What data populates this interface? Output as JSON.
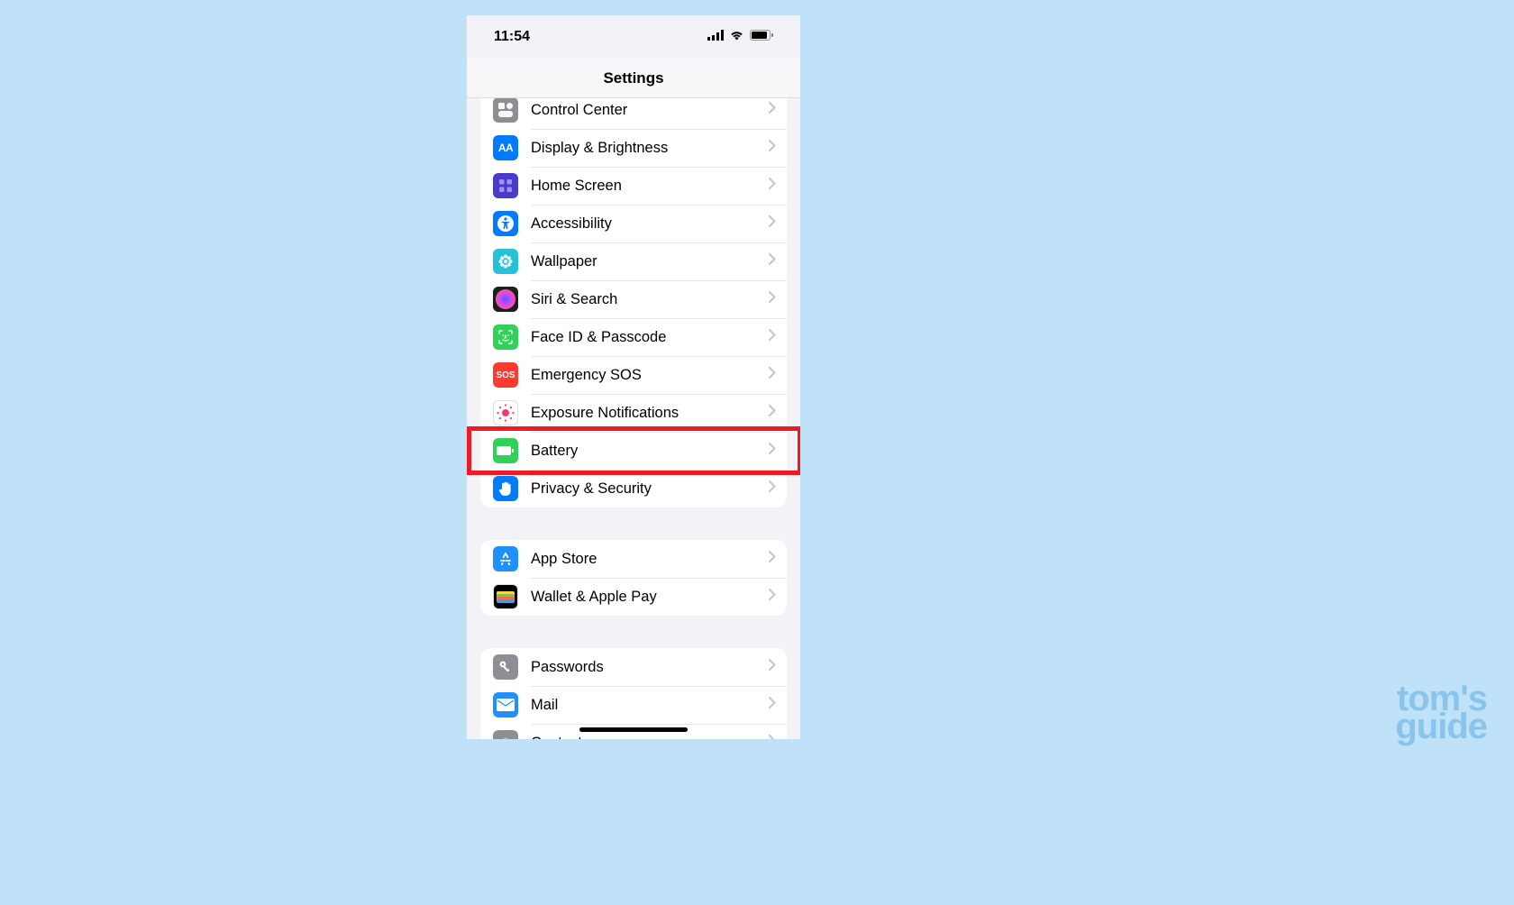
{
  "status": {
    "time": "11:54"
  },
  "header": {
    "title": "Settings"
  },
  "groups": [
    {
      "rows": [
        {
          "id": "control-center",
          "label": "Control Center",
          "icon_bg": "#8e8e93",
          "icon": "controlcenter"
        },
        {
          "id": "display-brightness",
          "label": "Display & Brightness",
          "icon_bg": "#007aff",
          "icon": "aa"
        },
        {
          "id": "home-screen",
          "label": "Home Screen",
          "icon_bg": "#493cc9",
          "icon": "grid"
        },
        {
          "id": "accessibility",
          "label": "Accessibility",
          "icon_bg": "#007aff",
          "icon": "accessibility"
        },
        {
          "id": "wallpaper",
          "label": "Wallpaper",
          "icon_bg": "#24c1d7",
          "icon": "flower"
        },
        {
          "id": "siri-search",
          "label": "Siri & Search",
          "icon_bg": "#1e1e1e",
          "icon": "siri"
        },
        {
          "id": "faceid-passcode",
          "label": "Face ID & Passcode",
          "icon_bg": "#30d158",
          "icon": "faceid"
        },
        {
          "id": "emergency-sos",
          "label": "Emergency SOS",
          "icon_bg": "#ff3b30",
          "icon": "sos"
        },
        {
          "id": "exposure-notifications",
          "label": "Exposure Notifications",
          "icon_bg": "#ffffff",
          "icon": "exposure"
        },
        {
          "id": "battery",
          "label": "Battery",
          "icon_bg": "#30d158",
          "icon": "battery",
          "highlighted": true
        },
        {
          "id": "privacy-security",
          "label": "Privacy & Security",
          "icon_bg": "#007aff",
          "icon": "hand"
        }
      ]
    },
    {
      "rows": [
        {
          "id": "app-store",
          "label": "App Store",
          "icon_bg": "#1e90ff",
          "icon": "appstore"
        },
        {
          "id": "wallet-apple-pay",
          "label": "Wallet & Apple Pay",
          "icon_bg": "#000000",
          "icon": "wallet"
        }
      ]
    },
    {
      "rows": [
        {
          "id": "passwords",
          "label": "Passwords",
          "icon_bg": "#8e8e93",
          "icon": "key"
        },
        {
          "id": "mail",
          "label": "Mail",
          "icon_bg": "#1e90ff",
          "icon": "mail"
        },
        {
          "id": "contacts",
          "label": "Contacts",
          "icon_bg": "#8e8e93",
          "icon": "contacts"
        }
      ]
    }
  ],
  "watermark": {
    "line1": "tom's",
    "line2": "guide"
  }
}
